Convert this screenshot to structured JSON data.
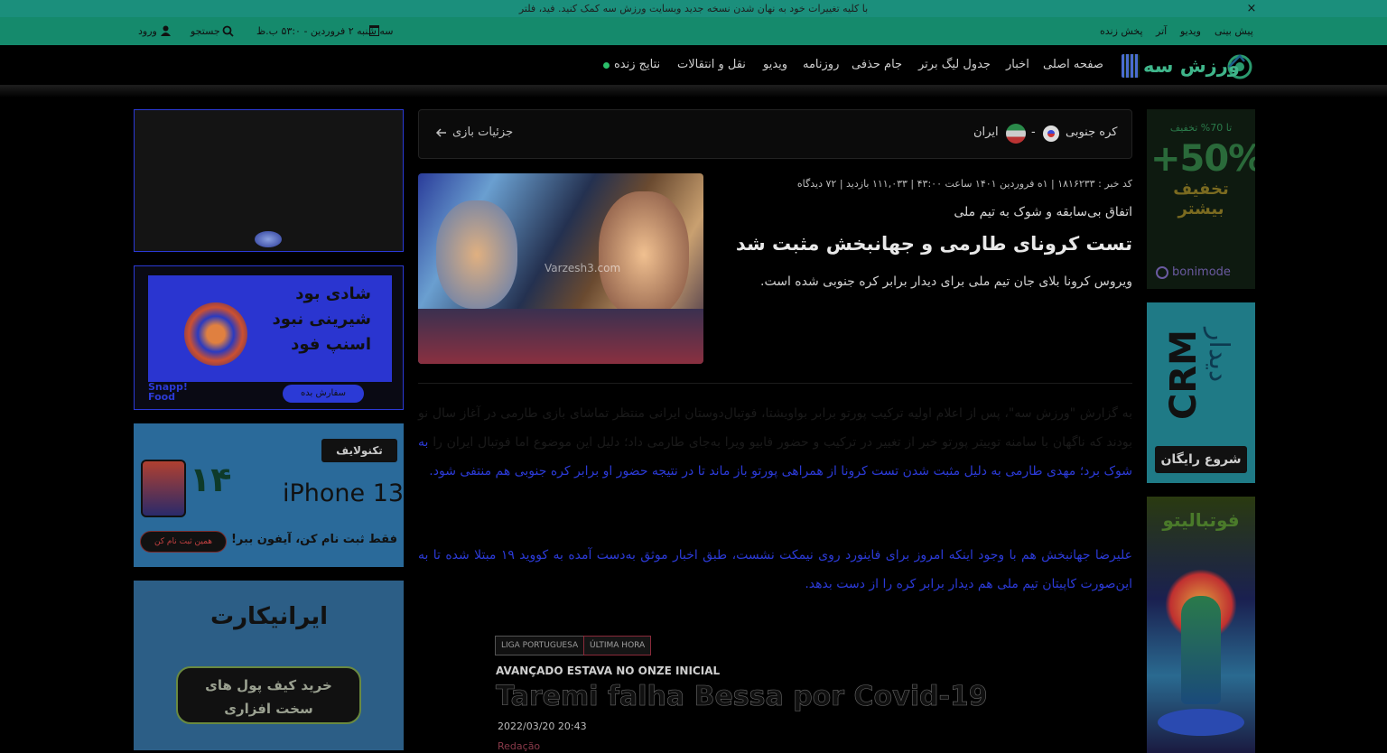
{
  "notice": {
    "text": "با کلیه تغییرات خود به نهان شدن نسخه جدید وبسایت ورزش سه کمک کنید. فید، فلتر",
    "close": "×"
  },
  "topbar": {
    "links": [
      "پخش زنده",
      "آتر",
      "ویدیو",
      "پیش بینی"
    ],
    "date": "سه شنبه ۲ فروردین - ۵۳:۰ ب.ظ",
    "search": "جستجو",
    "login": "ورود"
  },
  "nav": {
    "logo": "ورزش سه",
    "items": [
      "صفحه اصلی",
      "اخبار",
      "جدول لیگ برتر",
      "جام حذفی",
      "روزنامه",
      "ویدیو",
      "نقل و انتقالات",
      "نتایج زنده"
    ]
  },
  "match": {
    "home": "کره جنوبی",
    "sep": "-",
    "away": "ایران",
    "details": "جزئیات بازی"
  },
  "article": {
    "meta": "کد خبر : ۱۸۱۶۲۳۳ | ۱ه فروردین ۱۴۰۱ ساعت ۴۳:۰۰ | ۱۱۱,۰۳۳ بازدید | ۷۲ دیدگاه",
    "lead": "اتفاق بی‌سابقه و شوک به تیم ملی",
    "title": "تست کرونای طارمی و جهانبخش مثبت شد",
    "summary": "ویروس کرونا بلای جان تیم ملی برای دیدار برابر کره جنوبی شده است.",
    "image_watermark": "Varzesh3.com",
    "p1_a": "به گزارش \"ورزش سه\"، پس از اعلام اولیه ترکیب پورتو برابر بواویشتا، فوتبال‌دوستان ایرانی منتظر تماشای بازی طارمی در آغاز سال نو بودند که ناگهان با سامنه توییتر پورتو خبر از تغییر در ترکیب و حضور فابیو ویرا به‌جای طارمی داد؛ دلیل این موضوع اما فوتبال ایران را",
    "p1_b": "به شوک برد؛ مهدی طارمی به دلیل مثبت شدن تست کرونا از همراهی پورتو باز ماند تا در نتیجه حضور او برابر کره جنوبی هم منتفی شود.",
    "p2": "علیرضا جهانبخش هم با وجود اینکه امروز برای فاینورد روی نیمکت نشست، طبق اخبار موثق به‌دست آمده به کووید ۱۹ مبتلا شده تا به این‌صورت کاپیتان تیم ملی هم دیدار برابر کره را از دست بدهد."
  },
  "embed": {
    "tag1": "LIGA PORTUGUESA",
    "tag2": "ÚLTIMA HORA",
    "kicker": "AVANÇADO ESTAVA NO ONZE INICIAL",
    "headline": "Taremi falha Bessa por Covid-19",
    "date": "2022/03/20 20:43",
    "author": "Redação"
  },
  "ads": {
    "snapp_line1": "شادی بود",
    "snapp_line2": "شیرینی نبود",
    "snapp_line3": "اسنپ فود",
    "snapp_brand": "Snapp! Food",
    "snapp_cta": "سفارش بده",
    "tekno_brand": "تکنولایف",
    "tekno_product": "iPhone 13",
    "tekno_count": "۱۴",
    "tekno_tagline": "فقط ثبت نام کن، آیفون ببر!",
    "tekno_cta": "همین ثبت نام کن",
    "irani_brand": "ایرانیکارت",
    "irani_cta": "خرید کیف پول های سخت افزاری",
    "bonus_small": "تا 70% تخفیف",
    "bonus_big": "+50%",
    "bonus_text": "تخفیف بیشتر",
    "bonus_brand": "bonimode",
    "crm_title": "CRM",
    "crm_sub": "دیدار",
    "crm_cta": "شروع رایگان",
    "football_title": "فوتبالیتو"
  },
  "colors": {
    "teal": "#158a6c",
    "notice": "#1b8f7c",
    "blue": "#2b3ad6"
  }
}
